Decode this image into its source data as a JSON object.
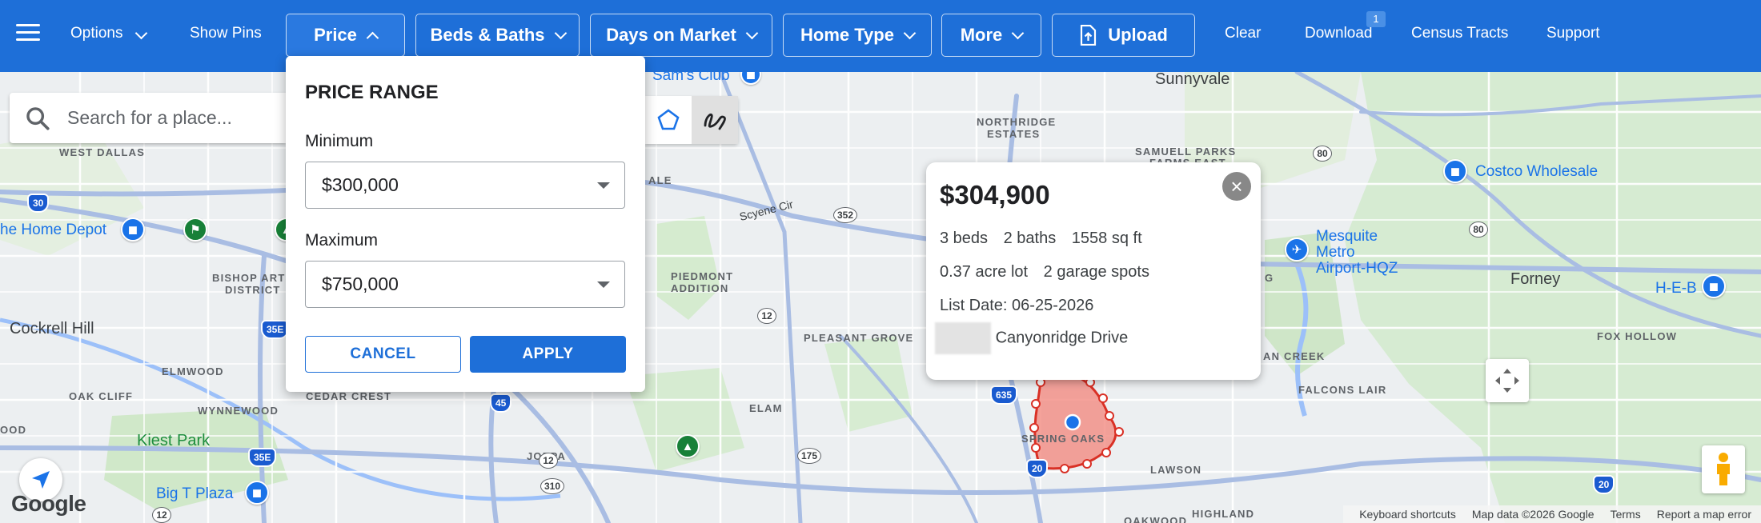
{
  "nav": {
    "options": "Options",
    "show_pins": "Show Pins",
    "price": "Price",
    "beds_baths": "Beds & Baths",
    "days_on_market": "Days on Market",
    "home_type": "Home Type",
    "more": "More",
    "upload": "Upload",
    "clear": "Clear",
    "download": "Download",
    "download_badge": "1",
    "census_tracts": "Census Tracts",
    "support": "Support"
  },
  "search": {
    "placeholder": "Search for a place..."
  },
  "price_panel": {
    "title": "PRICE RANGE",
    "minimum_label": "Minimum",
    "minimum_value": "$300,000",
    "maximum_label": "Maximum",
    "maximum_value": "$750,000",
    "cancel": "CANCEL",
    "apply": "APPLY"
  },
  "listing": {
    "price": "$304,900",
    "beds": "3 beds",
    "baths": "2 baths",
    "sqft": "1558 sq ft",
    "lot": "0.37 acre lot",
    "garage": "2 garage spots",
    "list_date": "List Date: 06-25-2026",
    "street": "Canyonridge Drive"
  },
  "map_labels": {
    "sunnyvale": "Sunnyvale",
    "northridge_estates_1": "NORTHRIDGE",
    "northridge_estates_2": "ESTATES",
    "samuell_parks_1": "SAMUELL PARKS",
    "samuell_parks_2": "FARMS EAST",
    "costco": "Costco Wholesale",
    "west_dallas": "WEST DALLAS",
    "home_depot": "he Home Depot",
    "bishop_arts_1": "BISHOP ARTS",
    "bishop_arts_2": "DISTRICT",
    "cockrell_hill": "Cockrell Hill",
    "elmwood": "ELMWOOD",
    "oak_cliff": "OAK CLIFF",
    "wynnewood": "WYNNEWOOD",
    "cedar_crest": "CEDAR CREST",
    "ood": "OOD",
    "kiest_park": "Kiest Park",
    "big_t_plaza": "Big T Plaza",
    "joppa": "JOPPA",
    "elam": "ELAM",
    "piedmont_1": "PIEDMONT",
    "piedmont_2": "ADDITION",
    "pleasant_grove": "PLEASANT GROVE",
    "scyene": "Scyene Cir",
    "ale": "ALE",
    "mesquite_1": "Mesquite",
    "mesquite_2": "Metro",
    "mesquite_3": "Airport-HQZ",
    "forney": "Forney",
    "heb": "H-E-B",
    "fox_hollow": "FOX HOLLOW",
    "falcons_lair": "FALCONS LAIR",
    "an_creek": "AN CREEK",
    "spring_oaks": "SPRING OAKS",
    "lawson": "LAWSON",
    "highland": "HIGHLAND",
    "oakwood": "OAKWOOD",
    "g_letter": "G",
    "sams_club": "Sam's Club"
  },
  "shields": {
    "i30": "30",
    "i35e_a": "35E",
    "i35e_b": "35E",
    "i45": "45",
    "i635": "635",
    "i20a": "20",
    "i20b": "20",
    "r352": "352",
    "r12a": "12",
    "r12b": "12",
    "r310": "310",
    "r175": "175",
    "r80a": "80",
    "r80b": "80",
    "r12c": "12"
  },
  "footer": {
    "shortcuts": "Keyboard shortcuts",
    "map_data": "Map data ©2026 Google",
    "terms": "Terms",
    "report": "Report a map error"
  },
  "google_logo": "Google",
  "colors": {
    "topbar": "#1e6fd8",
    "accent": "#1e6fd8",
    "polygon_fill": "#f28b82",
    "polygon_stroke": "#d93025",
    "road_highway": "#9fb4d9",
    "park": "#cfe8c9"
  },
  "icons": {
    "menu": "hamburger-icon",
    "upload": "upload-icon",
    "search": "search-icon",
    "polygon": "polygon-tool-icon",
    "freehand": "freehand-draw-icon",
    "close": "close-icon",
    "locate": "navigation-arrow-icon",
    "pan": "pan-arrows-icon",
    "pegman": "street-view-pegman-icon"
  }
}
